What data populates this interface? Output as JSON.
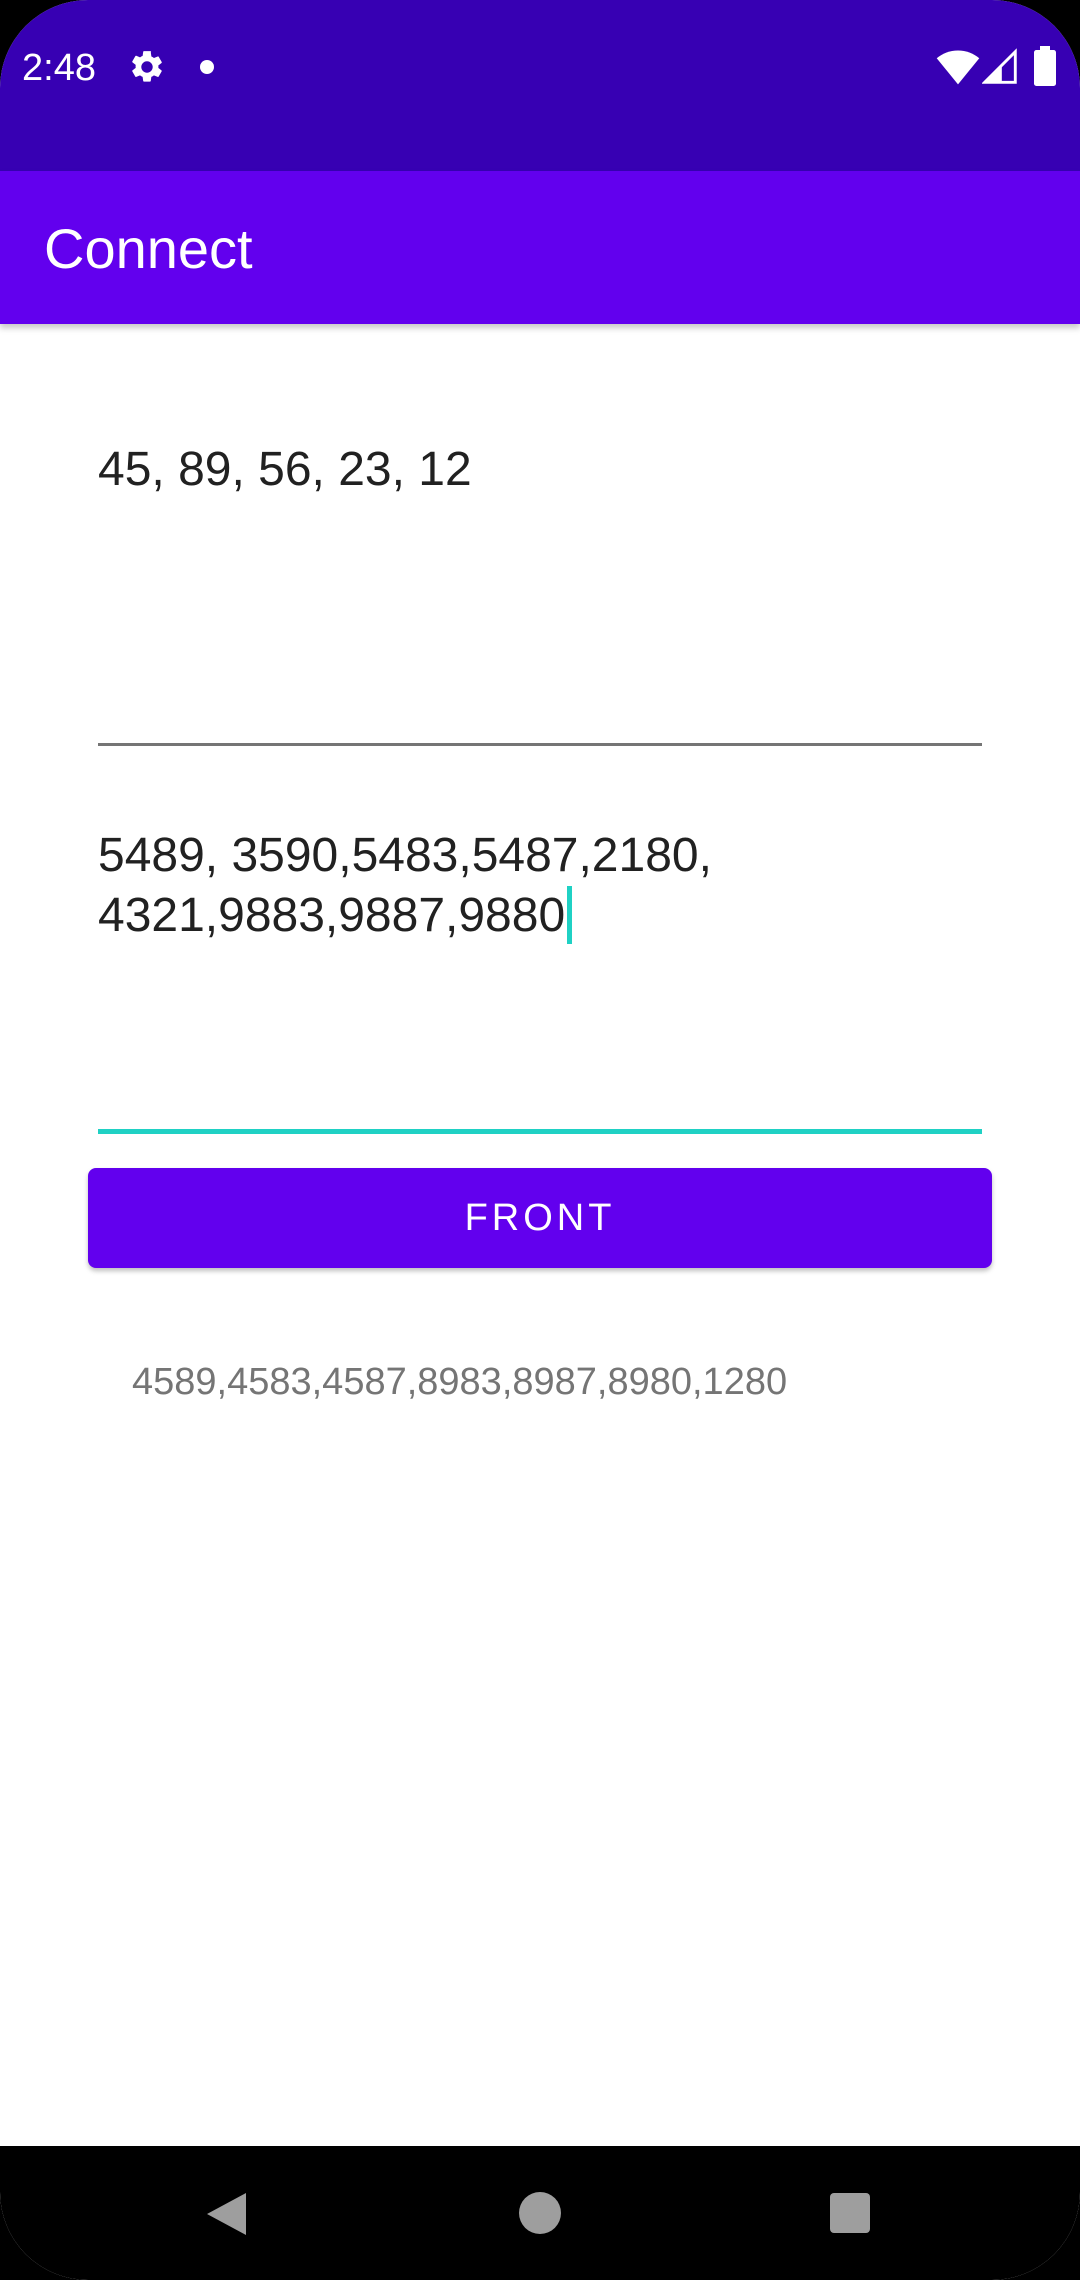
{
  "status_bar": {
    "time": "2:48",
    "icons": [
      "gear-icon",
      "dot-icon",
      "wifi-icon",
      "signal-icon",
      "battery-icon"
    ]
  },
  "app_bar": {
    "title": "Connect"
  },
  "inputs": {
    "first_value": "45, 89, 56, 23, 12",
    "second_value": "5489, 3590,5483,5487,2180,\n4321,9883,9887,9880"
  },
  "button": {
    "label": "FRONT"
  },
  "result": {
    "text": "4589,4583,4587,8983,8987,8980,1280"
  },
  "nav_bar": {
    "icons": [
      "back-icon",
      "home-icon",
      "recents-icon"
    ]
  },
  "colors": {
    "status_bar": "#3700b3",
    "primary": "#6200ee",
    "accent": "#1fd1c4"
  }
}
